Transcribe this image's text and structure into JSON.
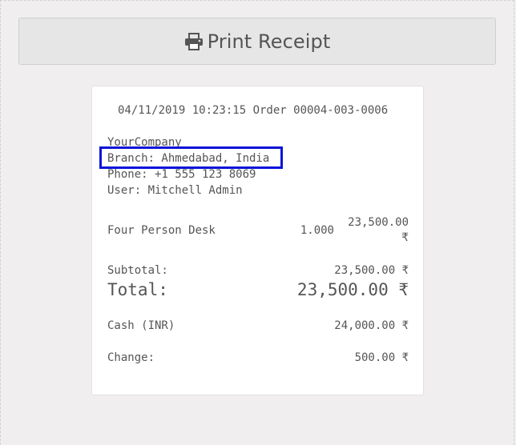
{
  "print_button": {
    "label": "Print Receipt",
    "icon": "print-icon"
  },
  "receipt": {
    "header": "04/11/2019 10:23:15 Order 00004-003-0006",
    "company": "YourCompany",
    "branch": "Branch: Ahmedabad, India",
    "phone": "Phone: +1 555 123 8069",
    "user": "User: Mitchell Admin",
    "lines": [
      {
        "product": "Four Person Desk",
        "qty": "1.000",
        "price": "23,500.00",
        "currency": "₹"
      }
    ],
    "subtotal_label": "Subtotal:",
    "subtotal_value": "23,500.00 ₹",
    "total_label": "Total:",
    "total_value": "23,500.00 ₹",
    "payment_label": "Cash (INR)",
    "payment_value": "24,000.00 ₹",
    "change_label": "Change:",
    "change_value": "500.00 ₹"
  },
  "colors": {
    "highlight_border": "#0a14d8",
    "page_background": "#f0eeee"
  }
}
